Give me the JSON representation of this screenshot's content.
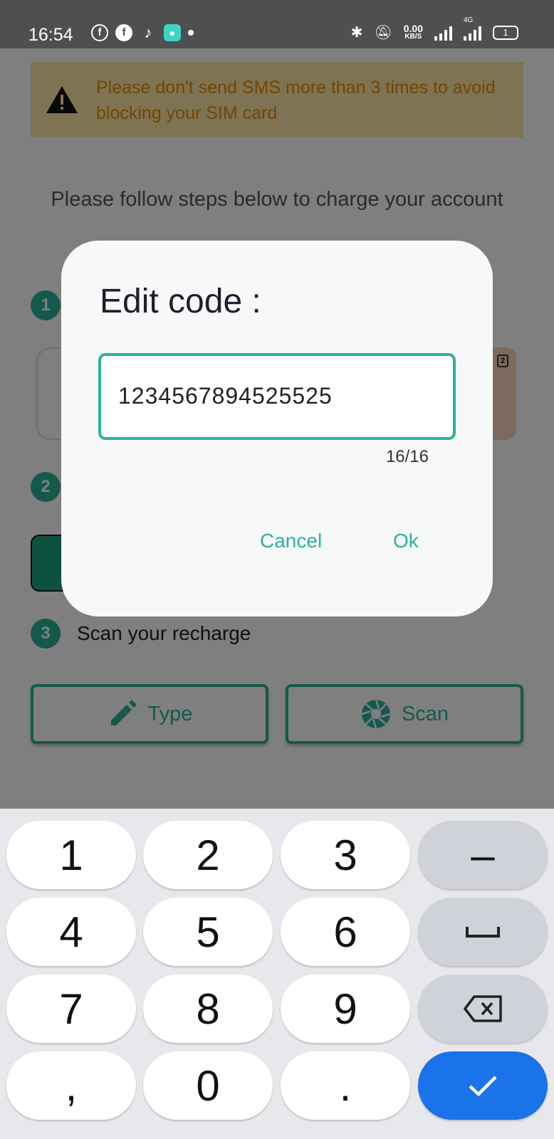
{
  "status_bar": {
    "time": "16:54",
    "kbs_value": "0.00",
    "kbs_unit": "KB/S",
    "network": "4G",
    "battery": "1",
    "left_icons": [
      "facebook-outline-icon",
      "facebook-icon",
      "tiktok-icon",
      "chat-app-icon",
      "notification-dot-icon"
    ],
    "right_icons": [
      "bluetooth-icon",
      "mute-icon",
      "signal-icon",
      "signal-4g-icon",
      "battery-icon"
    ]
  },
  "warning": {
    "text": "Please don't send SMS more than 3 times to avoid blocking your SIM card"
  },
  "instructions": "Please follow steps below to charge your account",
  "steps": [
    {
      "number": "1",
      "label": ""
    },
    {
      "number": "2",
      "label": ""
    },
    {
      "number": "3",
      "label": "Scan your recharge"
    }
  ],
  "sim_badge": "2",
  "buttons": {
    "type_label": "Type",
    "scan_label": "Scan"
  },
  "dialog": {
    "title": "Edit code :",
    "input_value": "1234567894525525",
    "counter": "16/16",
    "cancel_label": "Cancel",
    "ok_label": "Ok"
  },
  "keyboard": {
    "keys": [
      "1",
      "2",
      "3",
      "4",
      "5",
      "6",
      "7",
      "8",
      "9",
      ",",
      "0",
      "."
    ],
    "minus": "–"
  },
  "colors": {
    "accent": "#2bb39a",
    "warning_text": "#e68a00",
    "warning_bg": "#fce9a6",
    "enter_key": "#1a73e8"
  }
}
